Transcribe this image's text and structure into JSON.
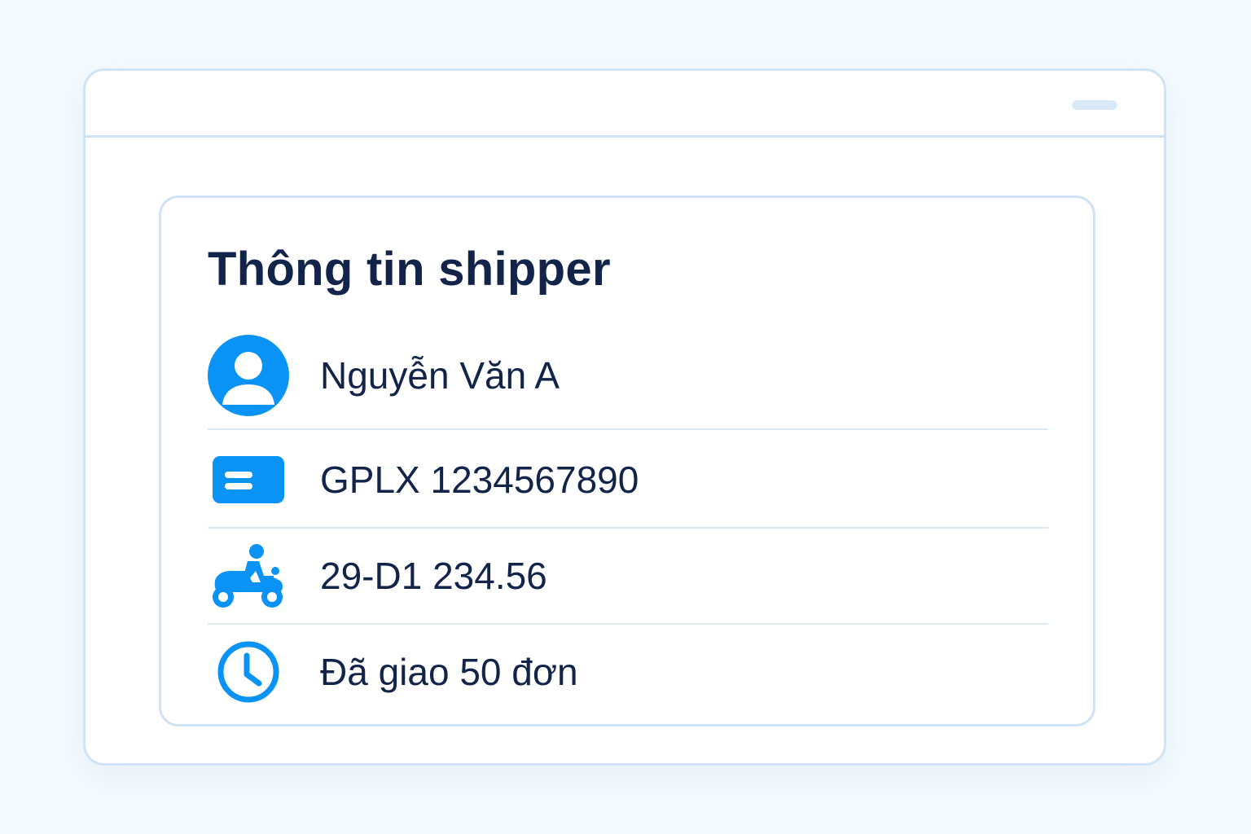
{
  "colors": {
    "accent": "#0a93f7",
    "text": "#12244a",
    "border": "#cfe2f6",
    "divider": "#dbe9f5",
    "background": "#f4fafd"
  },
  "card": {
    "title": "Thông tin shipper",
    "rows": [
      {
        "icon": "user-avatar-icon",
        "text": "Nguyễn Văn A"
      },
      {
        "icon": "id-card-icon",
        "text": "GPLX 1234567890"
      },
      {
        "icon": "motorbike-icon",
        "text": "29-D1 234.56"
      },
      {
        "icon": "clock-icon",
        "text": "Đã giao 50 đơn"
      }
    ]
  }
}
